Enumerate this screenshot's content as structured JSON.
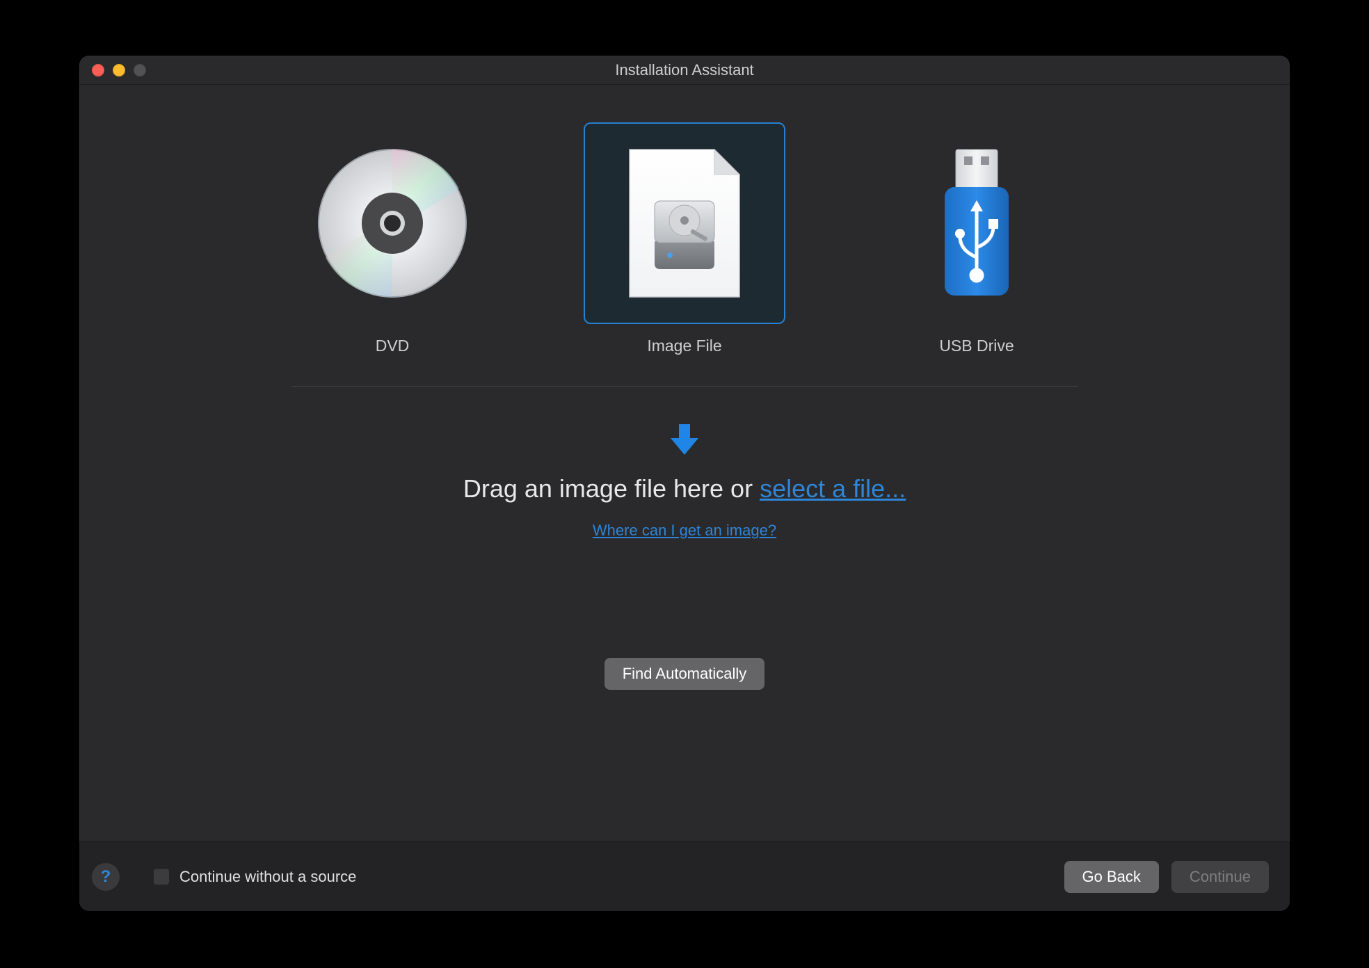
{
  "window_title": "Installation Assistant",
  "options": {
    "dvd": {
      "label": "DVD"
    },
    "image": {
      "label": "Image File"
    },
    "usb": {
      "label": "USB Drive"
    }
  },
  "drop_prompt_prefix": "Drag an image file here or ",
  "drop_prompt_link": "select a file...",
  "where_link": "Where can I get an image?",
  "find_button": "Find Automatically",
  "footer": {
    "continue_without": "Continue without a source",
    "go_back": "Go Back",
    "continue": "Continue"
  }
}
